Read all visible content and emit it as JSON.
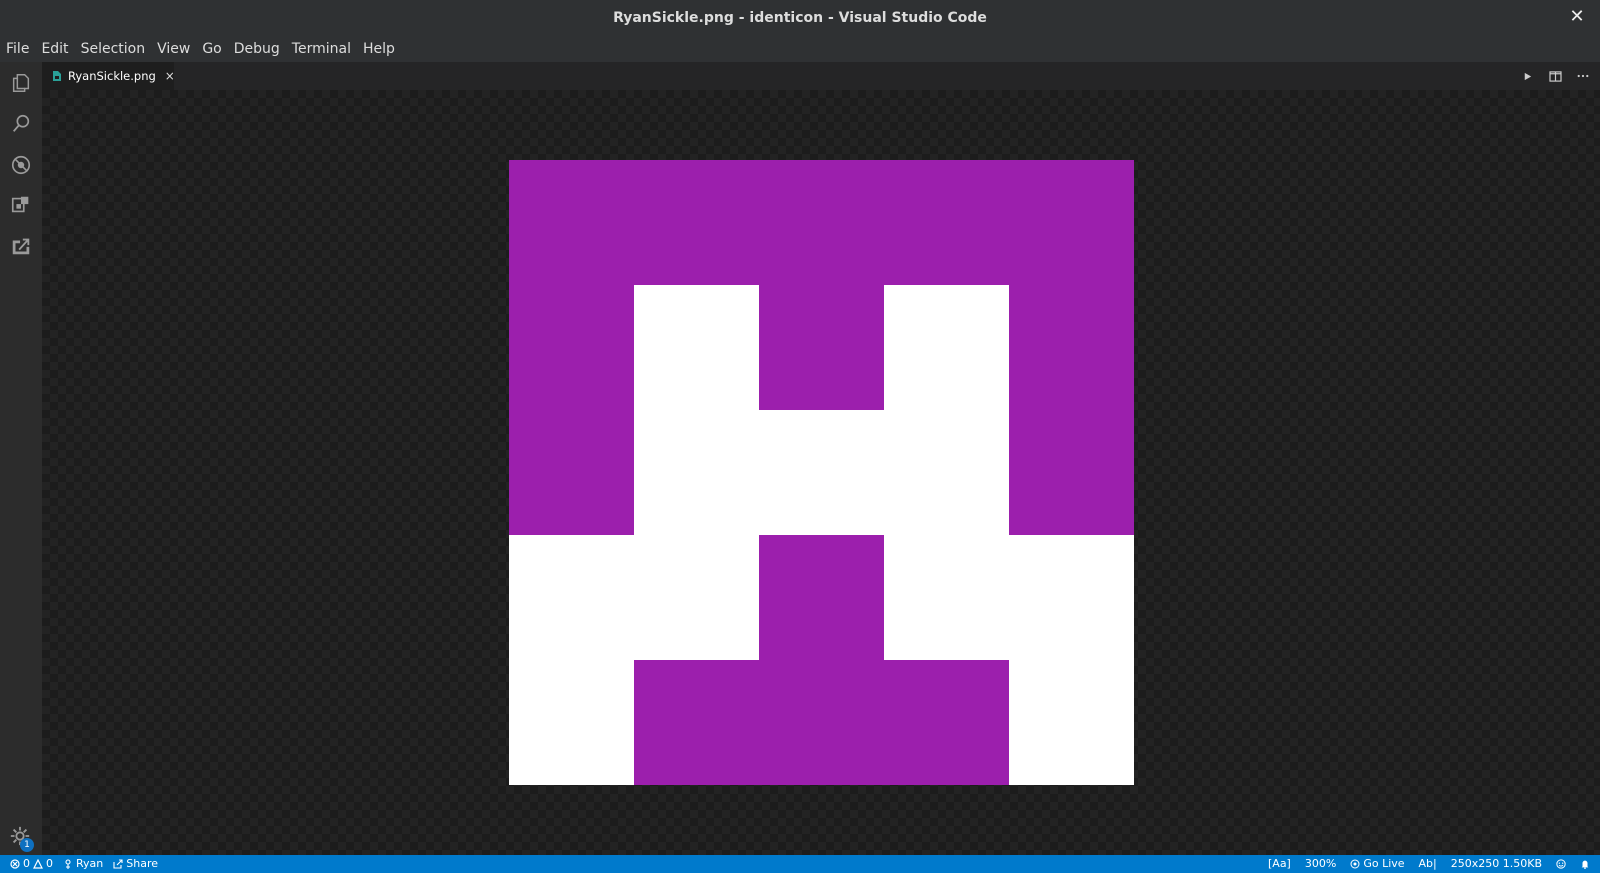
{
  "window": {
    "title": "RyanSickle.png - identicon - Visual Studio Code",
    "close_label": "✕"
  },
  "menu": [
    "File",
    "Edit",
    "Selection",
    "View",
    "Go",
    "Debug",
    "Terminal",
    "Help"
  ],
  "activity_bar": {
    "icons": [
      "explorer-icon",
      "search-icon",
      "debug-icon",
      "extensions-icon",
      "live-share-icon"
    ],
    "settings_badge": "1"
  },
  "tabs": [
    {
      "label": "RyanSickle.png",
      "close": "×",
      "active": true
    }
  ],
  "tab_actions": [
    "run-icon",
    "split-editor-icon",
    "more-actions-icon"
  ],
  "image": {
    "file": "RyanSickle.png",
    "foreground_color": "#9c1fad",
    "background_color": "#ffffff",
    "grid_size": 5,
    "pattern": [
      [
        1,
        1,
        1,
        1,
        1
      ],
      [
        1,
        0,
        1,
        0,
        1
      ],
      [
        1,
        0,
        0,
        0,
        1
      ],
      [
        0,
        0,
        1,
        0,
        0
      ],
      [
        0,
        1,
        1,
        1,
        0
      ]
    ]
  },
  "status": {
    "errors": "0",
    "warnings": "0",
    "user": "Ryan",
    "share": "Share",
    "case_sensitive": "[Aa]",
    "zoom": "300%",
    "go_live": "Go Live",
    "spell": "Ab|",
    "image_info": "250x250 1.50KB"
  },
  "colors": {
    "status_bar": "#007acc",
    "accent_badge": "#0e70c0"
  }
}
